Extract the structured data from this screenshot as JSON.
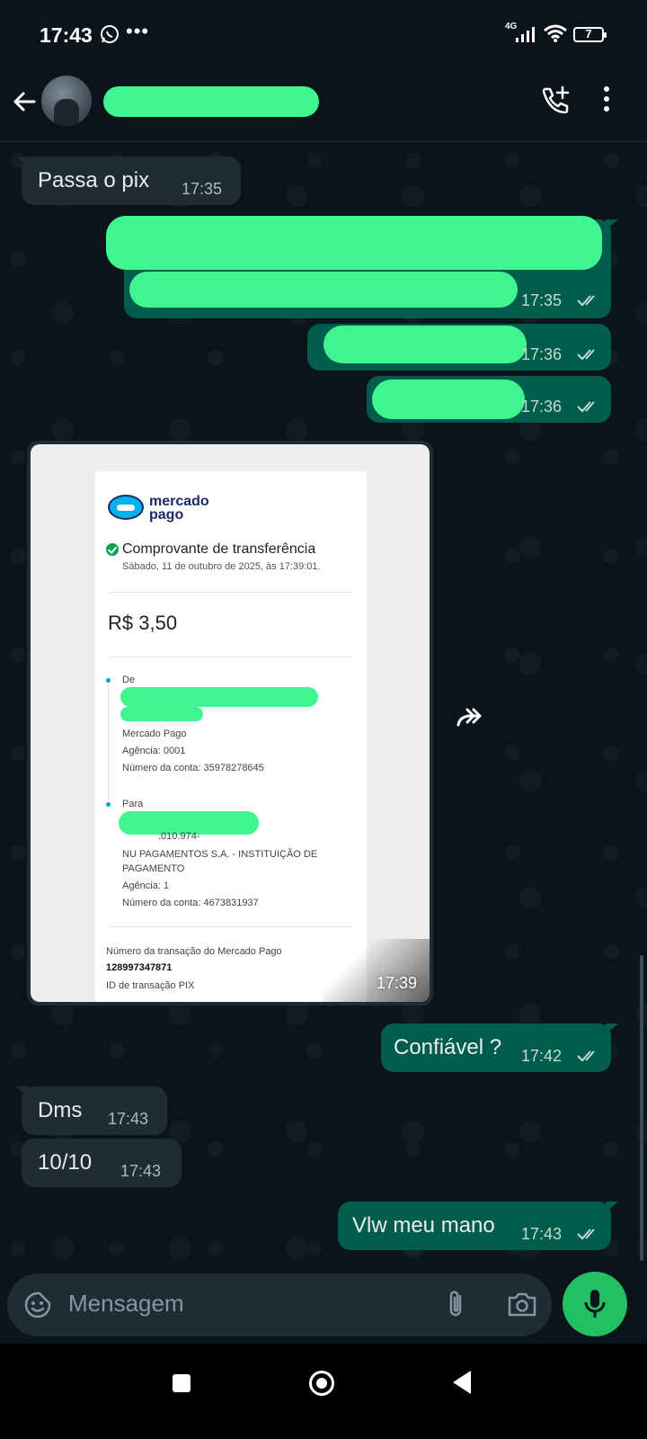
{
  "status_bar": {
    "time": "17:43",
    "extra": "•••",
    "network": "4G",
    "battery": "7"
  },
  "header": {
    "contact_name": ""
  },
  "messages": {
    "m1": {
      "text": "Passa o pix",
      "time": "17:35"
    },
    "m2": {
      "time": "17:35"
    },
    "m3": {
      "time": "17:36"
    },
    "m4": {
      "time": "17:36"
    },
    "m5": {
      "text": "Confiável ?",
      "time": "17:42"
    },
    "m6": {
      "text": "Dms",
      "time": "17:43"
    },
    "m7": {
      "text": "10/10",
      "time": "17:43"
    },
    "m8": {
      "text": "Vlw meu mano",
      "time": "17:43"
    }
  },
  "receipt": {
    "brand_line1": "mercado",
    "brand_line2": "pago",
    "title": "Comprovante de transferência",
    "date": "Sábado, 11 de outubro de 2025, às 17:39:01.",
    "amount": "R$ 3,50",
    "from_label": "De",
    "from_bank": "Mercado Pago",
    "from_agency": "Agência: 0001",
    "from_account": "Número da conta: 35978278645",
    "to_label": "Para",
    "to_cpf_partial": ".010.974-",
    "to_bank_line1": "NU PAGAMENTOS S.A. - INSTITUIÇÃO DE",
    "to_bank_line2": "PAGAMENTO",
    "to_agency": "Agência: 1",
    "to_account": "Número da conta: 4673831937",
    "txn_label": "Número da transação do Mercado Pago",
    "txn_number": "128997347871",
    "pix_label": "ID de transação PIX",
    "image_time": "17:39"
  },
  "composer": {
    "placeholder": "Mensagem"
  },
  "colors": {
    "incoming": "#202c33",
    "outgoing": "#005c4b",
    "accent": "#21c063",
    "redaction": "#3ef58f"
  }
}
